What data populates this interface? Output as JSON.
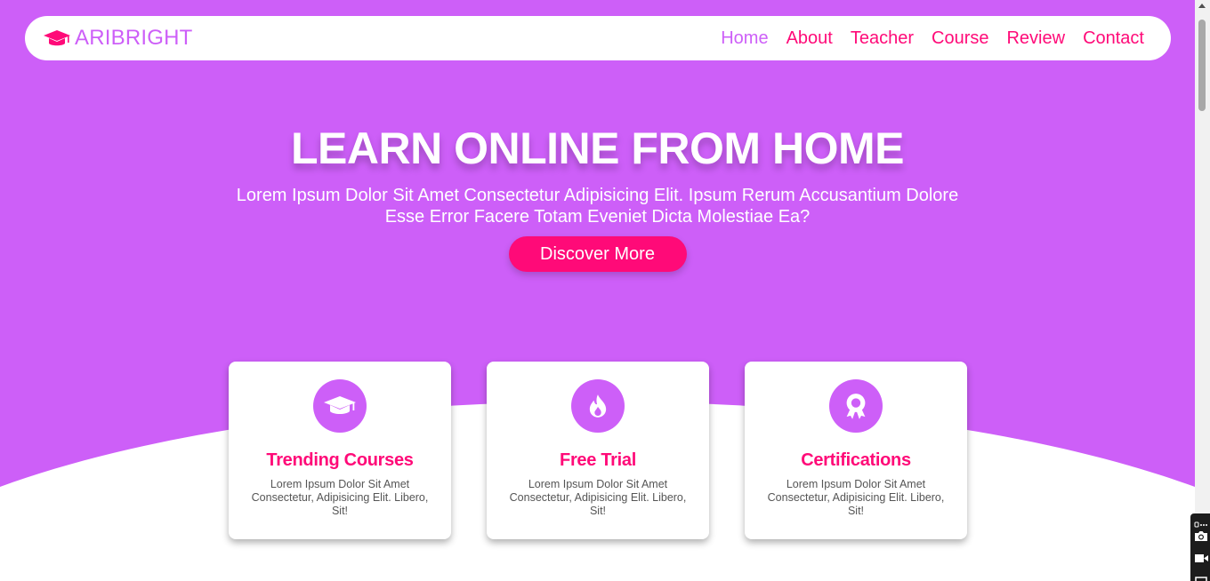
{
  "brand": {
    "name": "ARIBRIGHT",
    "icon": "graduation-cap-icon"
  },
  "nav": {
    "items": [
      {
        "label": "Home",
        "active": true
      },
      {
        "label": "About",
        "active": false
      },
      {
        "label": "Teacher",
        "active": false
      },
      {
        "label": "Course",
        "active": false
      },
      {
        "label": "Review",
        "active": false
      },
      {
        "label": "Contact",
        "active": false
      }
    ]
  },
  "hero": {
    "title": "LEARN ONLINE FROM HOME",
    "text": "Lorem Ipsum Dolor Sit Amet Consectetur Adipisicing Elit. Ipsum Rerum Accusantium Dolore Esse Error Facere Totam Eveniet Dicta Molestiae Ea?",
    "button": "Discover More"
  },
  "features": [
    {
      "icon": "graduation-cap-icon",
      "title": "Trending Courses",
      "text": "Lorem Ipsum Dolor Sit Amet Consectetur, Adipisicing Elit. Libero, Sit!"
    },
    {
      "icon": "fire-icon",
      "title": "Free Trial",
      "text": "Lorem Ipsum Dolor Sit Amet Consectetur, Adipisicing Elit. Libero, Sit!"
    },
    {
      "icon": "award-icon",
      "title": "Certifications",
      "text": "Lorem Ipsum Dolor Sit Amet Consectetur, Adipisicing Elit. Libero, Sit!"
    }
  ],
  "colors": {
    "primary": "#cd5ff8",
    "accent": "#ff0a78",
    "background": "#ffffff"
  }
}
